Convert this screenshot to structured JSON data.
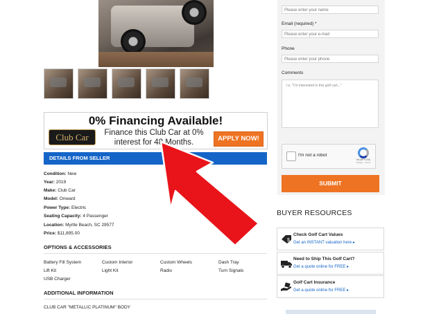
{
  "gallery": {
    "thumbnail_count": 5
  },
  "financing": {
    "headline": "0% Financing Available!",
    "logo_text": "Club Car",
    "line1": "Finance this Club Car at 0%",
    "line2": "interest for 48 Months.",
    "apply_label": "APPLY NOW!"
  },
  "details": {
    "header": "DETAILS FROM SELLER",
    "specs": [
      {
        "label": "Condition:",
        "value": "New"
      },
      {
        "label": "Year:",
        "value": "2019"
      },
      {
        "label": "Make:",
        "value": "Club Car"
      },
      {
        "label": "Model:",
        "value": "Onward"
      },
      {
        "label": "Power Type:",
        "value": "Electric"
      },
      {
        "label": "Seating Capacity:",
        "value": "4 Passenger"
      },
      {
        "label": "Location:",
        "value": "Myrtle Beach, SC 29577"
      },
      {
        "label": "Price:",
        "value": "$11,895.00"
      }
    ],
    "options_title": "OPTIONS & ACCESSORIES",
    "options": [
      [
        "Battery Fill System",
        "Custom Interior",
        "Custom Wheels",
        "Dash Tray"
      ],
      [
        "Lift Kit",
        "Light Kit",
        "Radio",
        "Turn Signals"
      ],
      [
        "USB Charger"
      ]
    ],
    "additional_title": "ADDITIONAL INFORMATION",
    "additional_text": "CLUB CAR \"METALLIC PLATINUM\" BODY"
  },
  "form": {
    "name_placeholder": "Please enter your name",
    "email_label": "Email (required) *",
    "email_placeholder": "Please enter your e-mail",
    "phone_label": "Phone",
    "phone_placeholder": "Please enter your phone",
    "comments_label": "Comments",
    "comments_placeholder": "I.e. \"I'm interested in this golf cart...\"",
    "captcha_label": "I'm not a robot",
    "captcha_brand": "reCAPTCHA",
    "captcha_links": "Privacy - Terms",
    "submit_label": "SUBMIT"
  },
  "resources": {
    "title": "BUYER RESOURCES",
    "items": [
      {
        "title": "Check Golf Cart Values",
        "link": "Get an INSTANT valuation here ▸",
        "icon": "dollar-tag-icon"
      },
      {
        "title": "Need to Ship This Golf Cart?",
        "link": "Get a quote online for FREE ▸",
        "icon": "truck-icon"
      },
      {
        "title": "Golf Cart Insurance",
        "link": "Get a quote online for FREE ▸",
        "icon": "insurance-hand-icon"
      }
    ]
  },
  "colors": {
    "accent_orange": "#ee7322",
    "header_blue": "#1565c8",
    "arrow_red": "#e8141a"
  }
}
